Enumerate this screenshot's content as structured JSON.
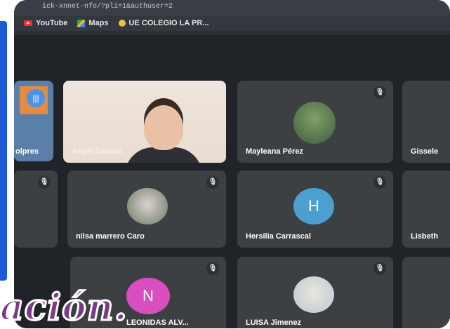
{
  "browser": {
    "url": "ick-xnnet-nfo/?pli=1&authuser=2",
    "bookmarks": [
      {
        "label": "YouTube",
        "icon": "youtube-icon"
      },
      {
        "label": "Maps",
        "icon": "maps-icon"
      },
      {
        "label": "UE COLEGIO LA PR...",
        "icon": "globe-icon"
      }
    ]
  },
  "participants": [
    {
      "name": "olpres",
      "partial": true
    },
    {
      "name": "Angel Daniels",
      "video": true
    },
    {
      "name": "Mayleana Pérez",
      "muted": true
    },
    {
      "name": "Gissele",
      "partial": true
    },
    {
      "name": "nilsa marrero Caro",
      "muted": true
    },
    {
      "name": "Hersilia Carrascal",
      "initial": "H",
      "muted": true
    },
    {
      "name": "Lisbeth",
      "partial": true
    },
    {
      "name": "LEONIDAS ALV...",
      "initial": "N",
      "muted": true
    },
    {
      "name": "LUISA Jimenez",
      "muted": true
    }
  ],
  "overlay": {
    "text": "ación."
  },
  "colors": {
    "accent": "#1d5bd6",
    "tile_bg": "#3c4043",
    "avatar_h": "#4b9fd1",
    "avatar_n": "#d94fc0",
    "overlay_text": "#7a3a85"
  }
}
